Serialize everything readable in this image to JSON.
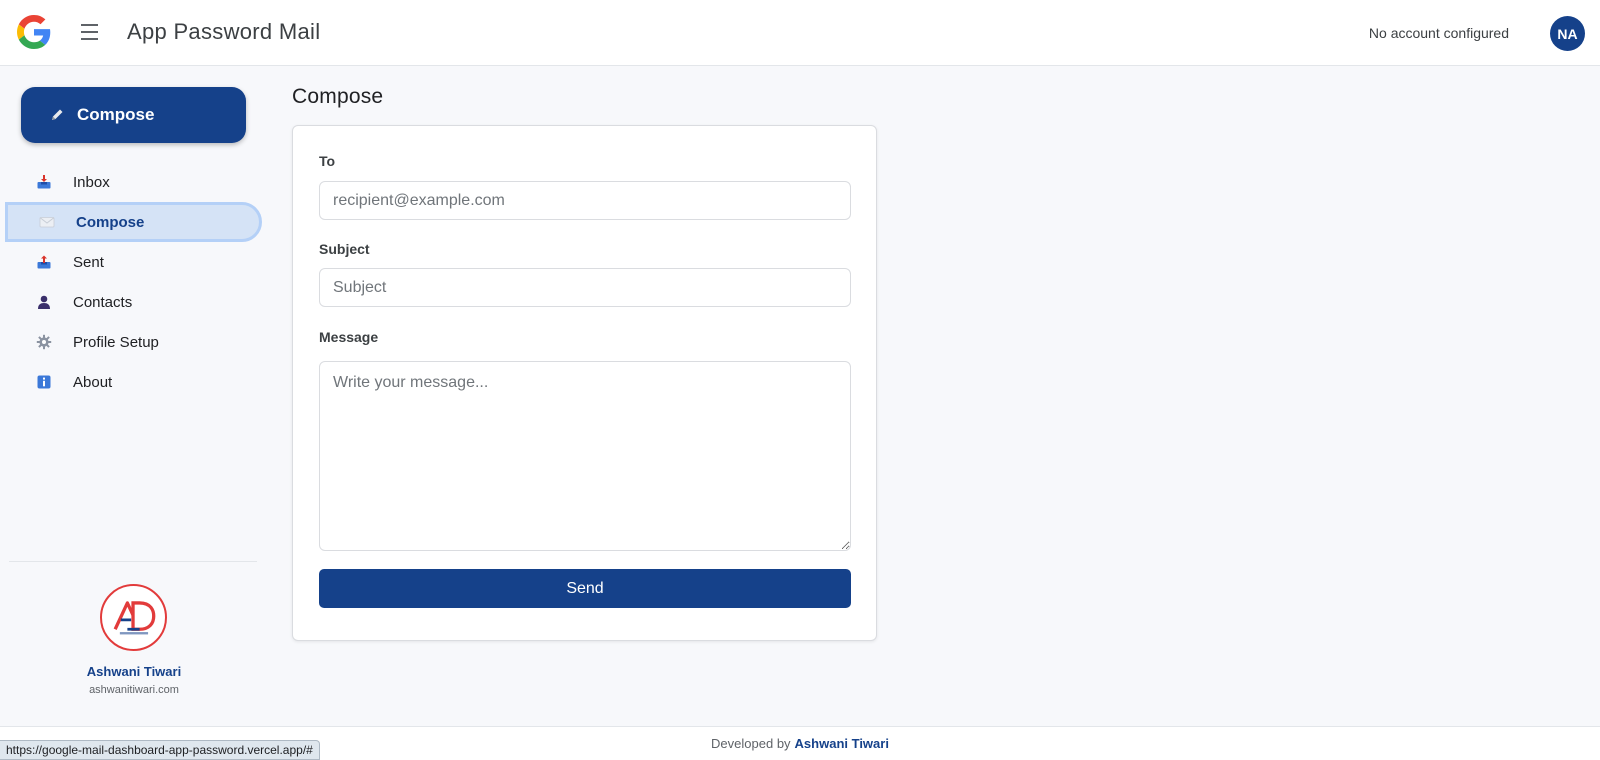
{
  "header": {
    "title": "App Password Mail",
    "account_status": "No account configured",
    "avatar_initials": "NA"
  },
  "sidebar": {
    "compose_label": "Compose",
    "items": [
      {
        "label": "Inbox",
        "icon": "inbox-tray-icon"
      },
      {
        "label": "Compose",
        "icon": "envelope-icon",
        "active": true
      },
      {
        "label": "Sent",
        "icon": "outbox-tray-icon"
      },
      {
        "label": "Contacts",
        "icon": "person-icon"
      },
      {
        "label": "Profile Setup",
        "icon": "gear-icon"
      },
      {
        "label": "About",
        "icon": "info-icon"
      }
    ],
    "developer": {
      "name": "Ashwani Tiwari",
      "site": "ashwanitiwari.com"
    }
  },
  "main": {
    "title": "Compose",
    "form": {
      "to_label": "To",
      "to_placeholder": "recipient@example.com",
      "to_value": "",
      "subject_label": "Subject",
      "subject_placeholder": "Subject",
      "subject_value": "",
      "message_label": "Message",
      "message_placeholder": "Write your message...",
      "message_value": "",
      "send_label": "Send"
    }
  },
  "footer": {
    "prefix": "Developed by",
    "name": "Ashwani Tiwari"
  },
  "status_bar": {
    "url": "https://google-mail-dashboard-app-password.vercel.app/#"
  },
  "colors": {
    "primary": "#15418a",
    "active_bg": "#d5e3f6",
    "active_border": "#b4d0f7",
    "background": "#f7f8fb"
  }
}
